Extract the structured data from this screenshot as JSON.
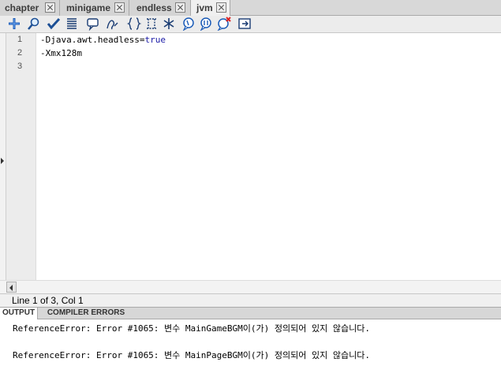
{
  "tabs": [
    {
      "label": "chapter"
    },
    {
      "label": "minigame"
    },
    {
      "label": "endless"
    },
    {
      "label": "jvm",
      "active": true
    }
  ],
  "toolbar": {
    "icons": [
      "add-icon",
      "find-icon",
      "check-syntax-icon",
      "format-icon",
      "comment-icon",
      "pencil-icon",
      "curly-braces-icon",
      "bracket-icon",
      "asterisk-icon",
      "add-comment-icon",
      "remove-comment-icon",
      "delete-comment-icon",
      "snippets-icon"
    ]
  },
  "editor": {
    "line_numbers": [
      "1",
      "2",
      "3"
    ],
    "lines": [
      {
        "key": "-Djava.awt.headless",
        "sep": "=",
        "value": "true"
      },
      {
        "key": "-Xmx128m",
        "sep": "",
        "value": ""
      },
      {
        "key": "",
        "sep": "",
        "value": ""
      }
    ]
  },
  "status": {
    "text": "Line 1 of 3, Col 1"
  },
  "panel": {
    "tabs": [
      "OUTPUT",
      "COMPILER ERRORS"
    ],
    "output_lines": [
      "ReferenceError: Error #1065: 변수 MainGameBGM이(가) 정의되어 있지 않습니다.",
      "ReferenceError: Error #1065: 변수 MainPageBGM이(가) 정의되어 있지 않습니다."
    ]
  },
  "colors": {
    "value_blue": "#1a1aa6",
    "tab_bg": "#d4d4d4",
    "toolbar_bg": "#ececec"
  }
}
